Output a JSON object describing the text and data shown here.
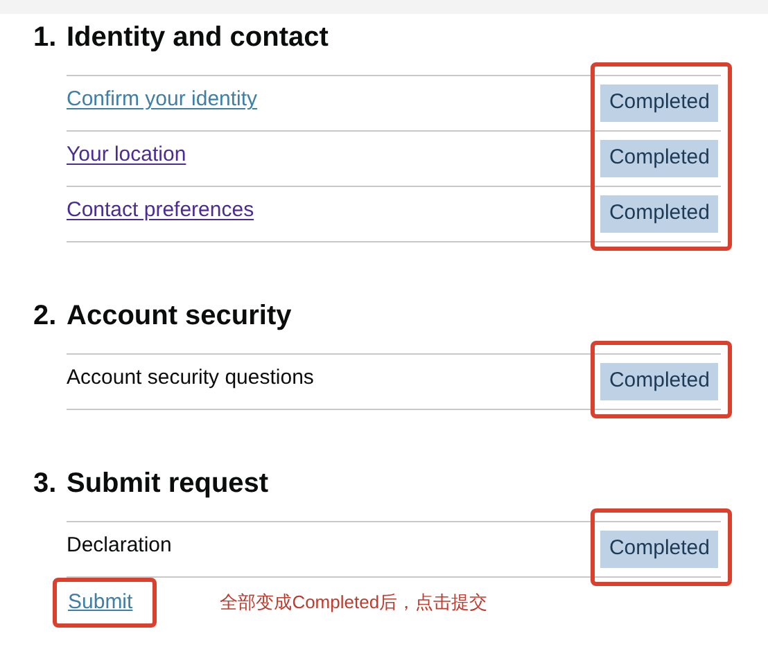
{
  "sections": [
    {
      "number": "1.",
      "title": "Identity and contact",
      "boxed": true,
      "tasks": [
        {
          "kind": "link",
          "label": "Confirm your identity",
          "visited": false,
          "status": "Completed"
        },
        {
          "kind": "link",
          "label": "Your location",
          "visited": true,
          "status": "Completed"
        },
        {
          "kind": "link",
          "label": "Contact preferences",
          "visited": true,
          "status": "Completed"
        }
      ]
    },
    {
      "number": "2.",
      "title": "Account security",
      "boxed": true,
      "tasks": [
        {
          "kind": "text",
          "label": "Account security questions",
          "status": "Completed"
        }
      ]
    },
    {
      "number": "3.",
      "title": "Submit request",
      "boxed": true,
      "tasks": [
        {
          "kind": "text",
          "label": "Declaration",
          "status": "Completed"
        }
      ]
    }
  ],
  "submit": {
    "label": "Submit",
    "boxed": true
  },
  "annotation": "全部变成Completed后，点击提交"
}
